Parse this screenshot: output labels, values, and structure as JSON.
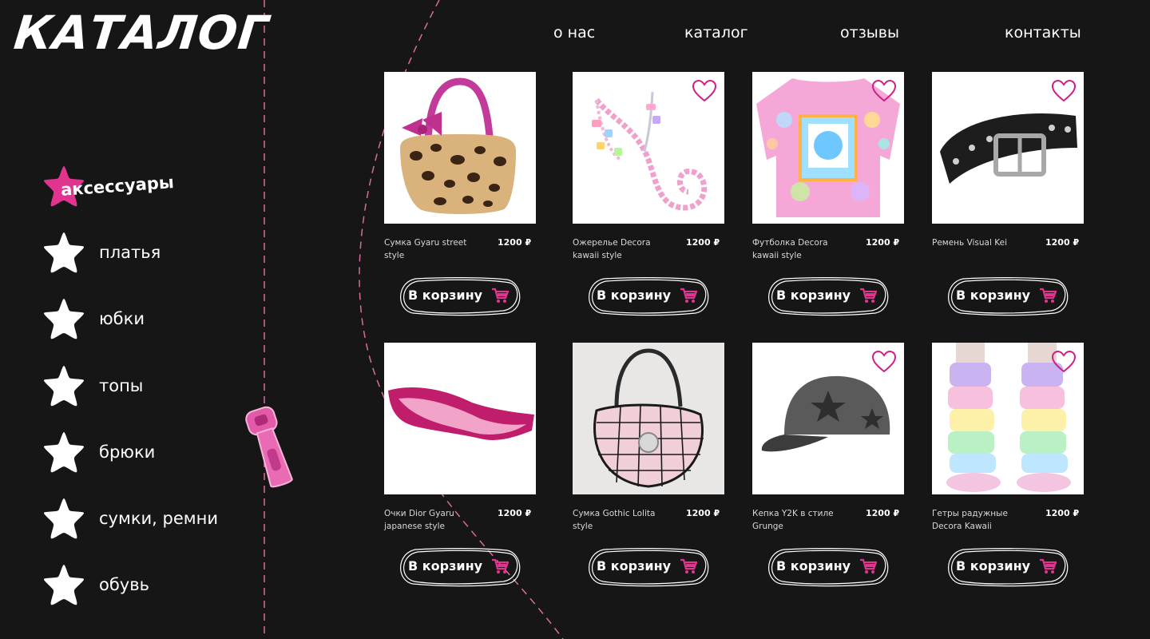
{
  "logo": "КАТАЛОГ",
  "nav": [
    "о нас",
    "каталог",
    "отзывы",
    "контакты"
  ],
  "categories": [
    {
      "label": "аксессуары",
      "active": true
    },
    {
      "label": "платья",
      "active": false
    },
    {
      "label": "юбки",
      "active": false
    },
    {
      "label": "топы",
      "active": false
    },
    {
      "label": "брюки",
      "active": false
    },
    {
      "label": "сумки, ремни",
      "active": false
    },
    {
      "label": "обувь",
      "active": false
    }
  ],
  "currency_note": "₽",
  "cart_button_label": "В корзину",
  "products": [
    {
      "name": "Сумка Gyaru street style",
      "price": "1200 ₽",
      "image": "leopard-fur-handbag",
      "favorite_icon": false
    },
    {
      "name": "Ожерелье Decora kawaii style",
      "price": "1200 ₽",
      "image": "pink-chain-necklace",
      "favorite_icon": true
    },
    {
      "name": "Футболка Decora kawaii style",
      "price": "1200 ₽",
      "image": "pastel-print-tshirt",
      "favorite_icon": true
    },
    {
      "name": "Ремень Visual Kei",
      "price": "1200 ₽",
      "image": "studded-star-belt",
      "favorite_icon": true
    },
    {
      "name": "Очки Dior Gyaru japanese style",
      "price": "1200 ₽",
      "image": "pink-shield-sunglasses",
      "favorite_icon": false
    },
    {
      "name": "Сумка Gothic Lolita style",
      "price": "1200 ₽",
      "image": "spiderweb-handbag",
      "favorite_icon": false
    },
    {
      "name": "Кепка Y2K в стиле Grunge",
      "price": "1200 ₽",
      "image": "grunge-star-cap",
      "favorite_icon": true
    },
    {
      "name": "Гетры радужные Decora Kawaii",
      "price": "1200 ₽",
      "image": "rainbow-leg-warmers",
      "favorite_icon": true
    }
  ],
  "colors": {
    "background": "#161616",
    "accent": "#e0348f",
    "text": "#ffffff",
    "divider": "#d86aa0"
  }
}
